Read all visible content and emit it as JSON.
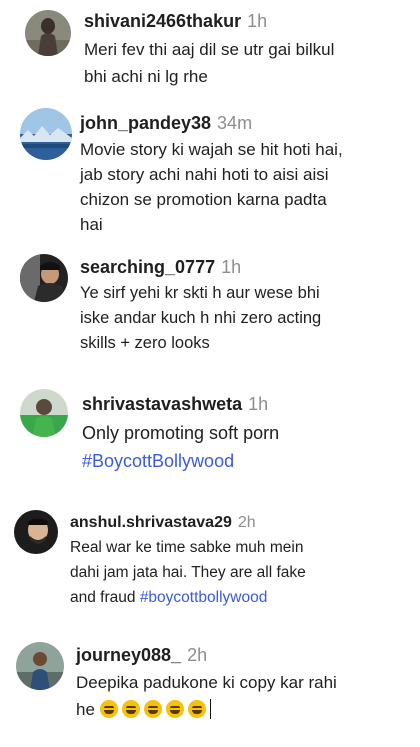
{
  "comments": [
    {
      "username": "shivani2466thakur",
      "time": "1h",
      "text": "Meri fev thi aaj dil se utr gai bilkul\nbhi achi ni lg rhe",
      "hashtag": ""
    },
    {
      "username": "john_pandey38",
      "time": "34m",
      "text": "Movie story ki wajah se hit hoti hai,\njab story achi nahi hoti to aisi aisi\nchizon se promotion karna padta\nhai",
      "hashtag": ""
    },
    {
      "username": "searching_0777",
      "time": "1h",
      "text": "Ye sirf yehi kr skti h aur wese bhi\niske andar kuch h nhi zero acting\nskills + zero looks",
      "hashtag": ""
    },
    {
      "username": "shrivastavashweta",
      "time": "1h",
      "text": "Only promoting soft porn\n",
      "hashtag": "#BoycottBollywood"
    },
    {
      "username": "anshul.shrivastava29",
      "time": "2h",
      "text": "Real war ke time sabke muh mein\ndahi jam jata hai. They are all fake\nand fraud ",
      "hashtag": "#boycottbollywood"
    },
    {
      "username": "journey088_",
      "time": "2h",
      "text": "Deepika padukone ki copy kar rahi\nhe ",
      "hashtag": "",
      "emoji_count": 5,
      "emoji": "grinning-face-emoji"
    }
  ]
}
